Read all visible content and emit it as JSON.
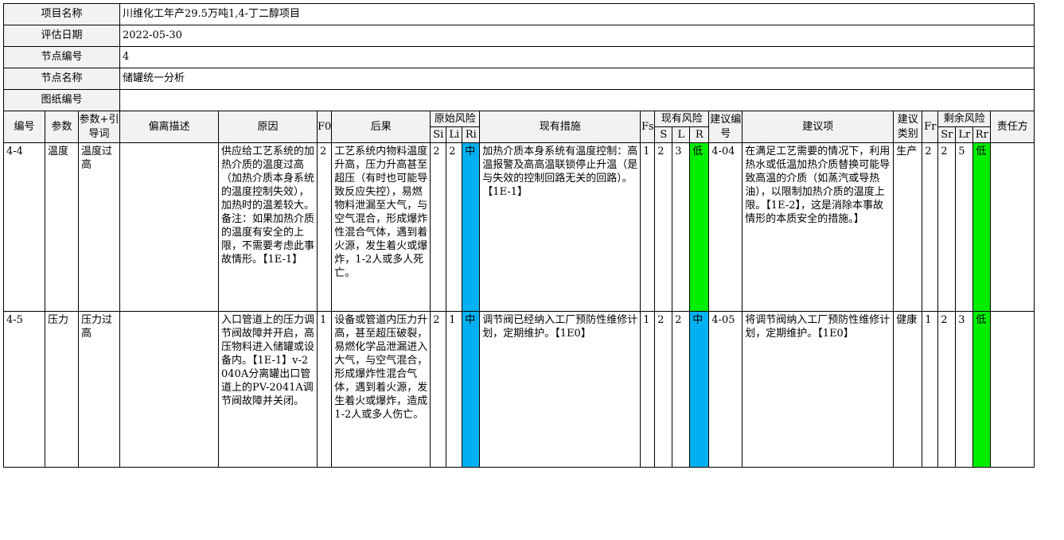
{
  "info": {
    "project_label": "项目名称",
    "project_value": "川维化工年产29.5万吨1,4-丁二醇项目",
    "date_label": "评估日期",
    "date_value": "2022-05-30",
    "node_label": "节点编号",
    "node_value": "4",
    "nodename_label": "节点名称",
    "nodename_value": "储罐统一分析",
    "drawing_label": "图纸编号",
    "drawing_value": ""
  },
  "headers": {
    "no": "编号",
    "param": "参数",
    "guide": "参数+引导词",
    "deviation": "偏离描述",
    "cause": "原因",
    "f0": "F0",
    "consequence": "后果",
    "orig_risk": "原始风险",
    "si": "Si",
    "li": "Li",
    "ri": "Ri",
    "measures": "现有措施",
    "fs": "Fs",
    "cur_risk": "现有风险",
    "s": "S",
    "l": "L",
    "r": "R",
    "sug_no": "建议编号",
    "suggestion": "建议项",
    "sug_type": "建议类别",
    "fr": "Fr",
    "res_risk": "剩余风险",
    "sr": "Sr",
    "lr": "Lr",
    "rr": "Rr",
    "owner": "责任方"
  },
  "rows": [
    {
      "no": "4-4",
      "param": "温度",
      "guide": "温度过高",
      "deviation": "",
      "cause": "供应给工艺系统的加热介质的温度过高（加热介质本身系统的温度控制失效），加热时的温差较大。备注：如果加热介质的温度有安全的上限，不需要考虑此事故情形。【1E-1】",
      "f0": "2",
      "consequence": "工艺系统内物料温度升高，压力升高甚至超压（有时也可能导致反应失控），易燃物料泄漏至大气，与空气混合，形成爆炸性混合气体，遇到着火源，发生着火或爆炸，1-2人或多人死亡。",
      "si": "2",
      "li": "2",
      "ri": "中",
      "measures": "加热介质本身系统有温度控制：高温报警及高高温联锁停止升温（是与失效的控制回路无关的回路）。【1E-1】",
      "fs": "1",
      "s": "2",
      "l": "3",
      "r": "低",
      "sug_no": "4-04",
      "suggestion": "在满足工艺需要的情况下，利用热水或低温加热介质替换可能导致高温的介质（如蒸汽或导热油），以限制加热介质的温度上限。【1E-2】，这是消除本事故情形的本质安全的措施。】",
      "sug_type": "生产",
      "fr": "2",
      "sr": "2",
      "lr": "5",
      "rr": "低",
      "owner": ""
    },
    {
      "no": "4-5",
      "param": "压力",
      "guide": "压力过高",
      "deviation": "",
      "cause": "入口管道上的压力调节阀故障并开启，高压物料进入储罐或设备内。【1E-1】v-2040A分离罐出口管道上的PV-2041A调节阀故障并关闭。",
      "f0": "1",
      "consequence": "设备或管道内压力升高，甚至超压破裂，易燃化学品泄漏进入大气，与空气混合，形成爆炸性混合气体，遇到着火源，发生着火或爆炸，造成1-2人或多人伤亡。",
      "si": "2",
      "li": "1",
      "ri": "中",
      "measures": "调节阀已经纳入工厂预防性维修计划，定期维护。【1E0】",
      "fs": "1",
      "s": "2",
      "l": "2",
      "r": "中",
      "sug_no": "4-05",
      "suggestion": "将调节阀纳入工厂预防性维修计划，定期维护。【1E0】",
      "sug_type": "健康",
      "fr": "1",
      "sr": "2",
      "lr": "3",
      "rr": "低",
      "owner": ""
    }
  ],
  "colors": {
    "medium": "#00b0f0",
    "low": "#00ee00",
    "header_bg": "#f2f2f2"
  }
}
